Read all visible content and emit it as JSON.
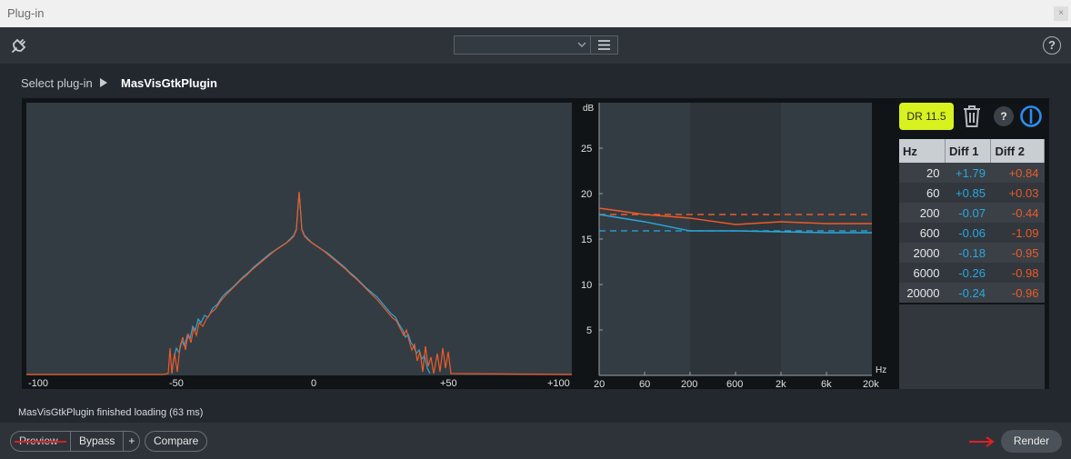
{
  "window": {
    "title": "Plug-in",
    "close_label": "×"
  },
  "toolbar": {
    "plug_icon": "plug-icon",
    "preset_value": "",
    "help_label": "?"
  },
  "breadcrumb": {
    "label": "Select plug-in",
    "plugin": "MasVisGtkPlugin"
  },
  "spectrum": {
    "x_ticks": [
      "-100",
      "-50",
      "0",
      "+50",
      "+100"
    ],
    "colors": {
      "series1": "#29a8e0",
      "series2": "#ef5a28"
    }
  },
  "eq_chart": {
    "y_unit": "dB",
    "x_unit": "Hz",
    "y_ticks": [
      "25",
      "20",
      "15",
      "10",
      "5"
    ],
    "x_ticks": [
      "20",
      "60",
      "200",
      "600",
      "2k",
      "6k",
      "20k"
    ]
  },
  "controls": {
    "dr_label": "DR 11.5",
    "help_label": "?"
  },
  "diff_table": {
    "headers": [
      "Hz",
      "Diff 1",
      "Diff 2"
    ],
    "rows": [
      [
        "20",
        "+1.79",
        "+0.84"
      ],
      [
        "60",
        "+0.85",
        "+0.03"
      ],
      [
        "200",
        "-0.07",
        "-0.44"
      ],
      [
        "600",
        "-0.06",
        "-1.09"
      ],
      [
        "2000",
        "-0.18",
        "-0.95"
      ],
      [
        "6000",
        "-0.26",
        "-0.98"
      ],
      [
        "20000",
        "-0.24",
        "-0.96"
      ]
    ]
  },
  "status": "MasVisGtkPlugin finished loading (63 ms)",
  "bottom": {
    "preview": "Preview",
    "bypass": "Bypass",
    "plus": "+",
    "compare": "Compare",
    "render": "Render"
  }
}
